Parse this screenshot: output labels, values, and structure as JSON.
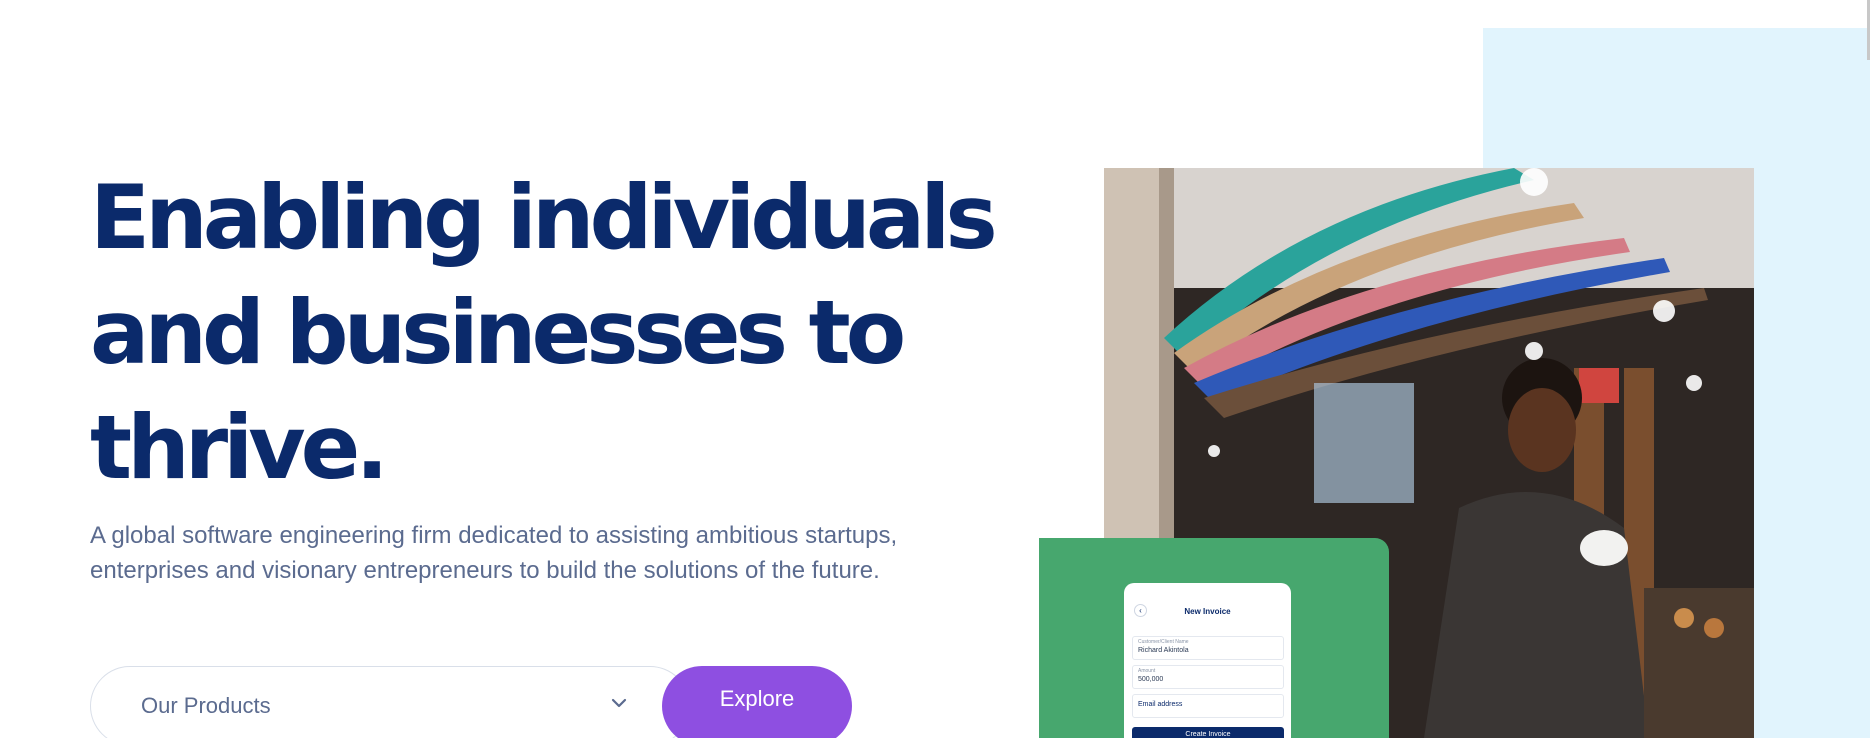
{
  "hero": {
    "headline_lines": [
      "Enabling individuals",
      "and businesses to",
      "thrive."
    ],
    "subtitle_lines": [
      "A global software engineering firm dedicated to assisting ambitious startups,",
      "enterprises and visionary entrepreneurs to build the solutions of the future."
    ]
  },
  "product_selector": {
    "selected_value": "Our Products",
    "icon": "chevron-down-icon",
    "explore_label": "Explore"
  },
  "invoice_mockup": {
    "title": "New Invoice",
    "back_icon": "chevron-left-icon",
    "fields": [
      {
        "label": "Customer/Client Name",
        "value": "Richard Akintola"
      },
      {
        "label": "Amount",
        "value": "500,000"
      },
      {
        "placeholder": "Email address"
      }
    ],
    "button_label": "Create Invoice"
  },
  "colors": {
    "headline": "#0b2a6b",
    "subtitle": "#5b6b8f",
    "accent_button": "#8e4fe1",
    "green_card": "#47a76e",
    "light_panel": "#e1f4fd"
  }
}
